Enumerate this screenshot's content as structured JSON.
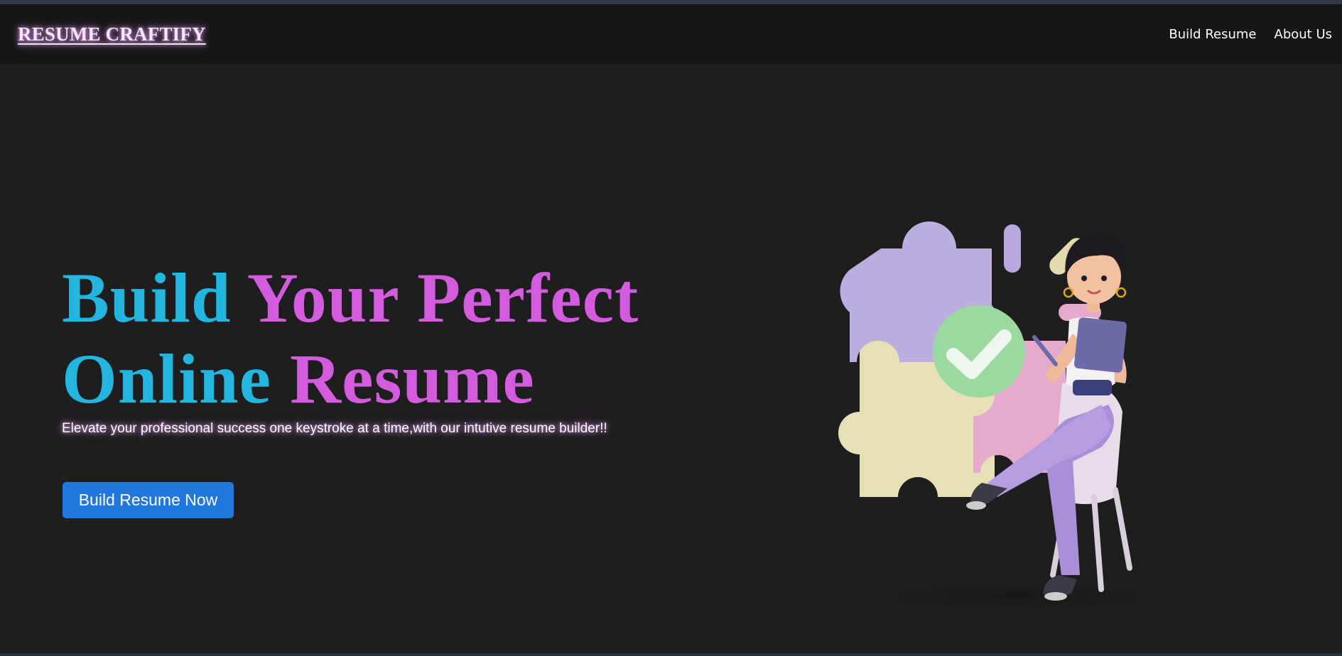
{
  "navbar": {
    "brand": "RESUME CRAFTIFY",
    "links": [
      "Build Resume",
      "About Us"
    ]
  },
  "hero": {
    "title_line1": [
      "Build",
      "Your Perfect"
    ],
    "title_line2": [
      "Online",
      "Resume"
    ],
    "subtitle": "Elevate your professional success one keystroke at a time,with our intutive resume builder!!",
    "cta_label": "Build Resume Now",
    "illustration_icon": "woman-with-tablet-and-puzzle-illustration"
  },
  "colors": {
    "background": "#1e1e1e",
    "navbar": "#161616",
    "title_cyan": "#22b5e0",
    "title_pink": "#d35bde",
    "cta": "#2277df"
  }
}
